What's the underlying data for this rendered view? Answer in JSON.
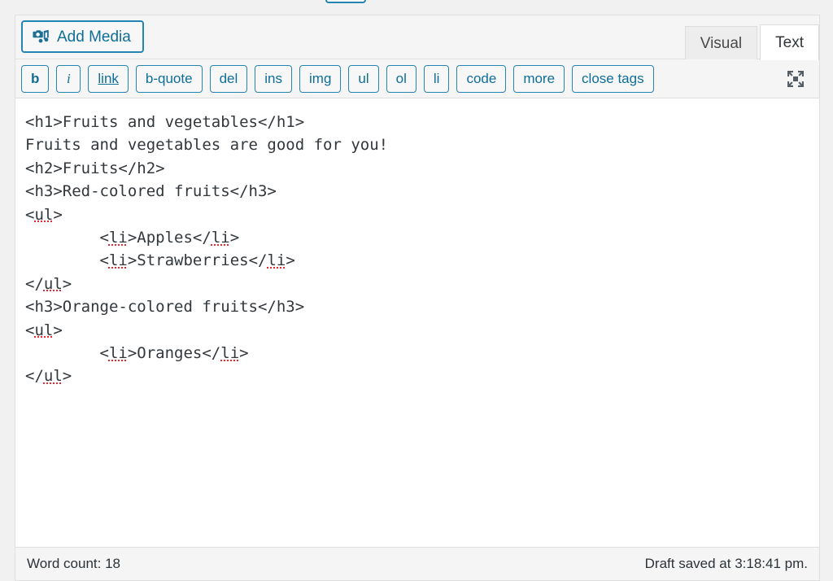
{
  "editor": {
    "media": {
      "add_media_label": "Add Media",
      "icon": "admin-media-icon"
    },
    "tabs": [
      {
        "label": "Visual",
        "active": false
      },
      {
        "label": "Text",
        "active": true
      }
    ],
    "quicktags": [
      {
        "label": "b",
        "style": "bold",
        "name": "bold"
      },
      {
        "label": "i",
        "style": "italic",
        "name": "italic"
      },
      {
        "label": "link",
        "style": "under",
        "name": "link"
      },
      {
        "label": "b-quote",
        "style": "",
        "name": "blockquote"
      },
      {
        "label": "del",
        "style": "",
        "name": "del"
      },
      {
        "label": "ins",
        "style": "",
        "name": "ins"
      },
      {
        "label": "img",
        "style": "",
        "name": "img"
      },
      {
        "label": "ul",
        "style": "",
        "name": "ul"
      },
      {
        "label": "ol",
        "style": "",
        "name": "ol"
      },
      {
        "label": "li",
        "style": "",
        "name": "li"
      },
      {
        "label": "code",
        "style": "",
        "name": "code"
      },
      {
        "label": "more",
        "style": "",
        "name": "more"
      },
      {
        "label": "close-tags",
        "style": "",
        "name": "close-tags",
        "display": "close tags"
      }
    ],
    "fullscreen_icon": "fullscreen-expand-icon",
    "content_lines": [
      {
        "text": "<h1>Fruits and vegetables</h1>",
        "misspelled": []
      },
      {
        "text": "Fruits and vegetables are good for you!",
        "misspelled": []
      },
      {
        "text": "<h2>Fruits</h2>",
        "misspelled": []
      },
      {
        "text": "<h3>Red-colored fruits</h3>",
        "misspelled": []
      },
      {
        "text": "<ul>",
        "misspelled": [
          "ul"
        ]
      },
      {
        "text": "\t<li>Apples</li>",
        "misspelled": [
          "li",
          "li"
        ]
      },
      {
        "text": "\t<li>Strawberries</li>",
        "misspelled": [
          "li",
          "li"
        ]
      },
      {
        "text": "</ul>",
        "misspelled": [
          "ul"
        ]
      },
      {
        "text": "<h3>Orange-colored fruits</h3>",
        "misspelled": []
      },
      {
        "text": "<ul>",
        "misspelled": [
          "ul"
        ]
      },
      {
        "text": "\t<li>Oranges</li>",
        "misspelled": [
          "li",
          "li"
        ]
      },
      {
        "text": "</ul>",
        "misspelled": [
          "ul"
        ]
      }
    ],
    "content_raw": "<h1>Fruits and vegetables</h1>\nFruits and vegetables are good for you!\n<h2>Fruits</h2>\n<h3>Red-colored fruits</h3>\n<ul>\n\t<li>Apples</li>\n\t<li>Strawberries</li>\n</ul>\n<h3>Orange-colored fruits</h3>\n<ul>\n\t<li>Oranges</li>\n</ul>",
    "status": {
      "word_count_label": "Word count: 18",
      "word_count": 18,
      "draft_saved_label": "Draft saved at 3:18:41 pm.",
      "draft_saved_time": "3:18:41 pm"
    }
  },
  "colors": {
    "accent_blue": "#0f6e97",
    "border_blue": "#2585b2",
    "spellcheck_red": "#e8282f",
    "panel_bg": "#ffffff",
    "chrome_bg": "#f5f5f5",
    "page_bg": "#f1f1f1"
  }
}
